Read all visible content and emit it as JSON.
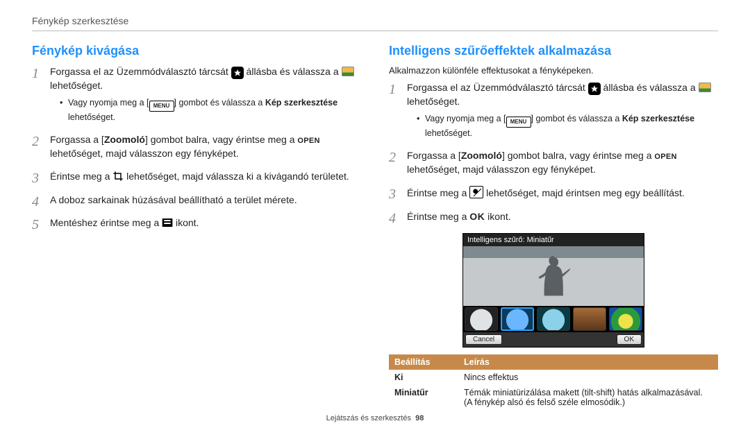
{
  "page_header": "Fénykép szerkesztése",
  "footer": {
    "section": "Lejátszás és szerkesztés",
    "page_no": "98"
  },
  "icons": {
    "star": "csillag",
    "gallery": "galéria",
    "menu": "MENU",
    "crop": "kivágás",
    "save": "mentés",
    "frame": "effektus-keret",
    "ok": "OK"
  },
  "left": {
    "title": "Fénykép kivágása",
    "steps": [
      {
        "pre": "Forgassa el az Üzemmódválasztó tárcsát ",
        "mid": " állásba és válassza a ",
        "post": " lehetőséget.",
        "sub": {
          "pre": "Vagy nyomja meg a [",
          "mid": "] gombot és válassza a ",
          "bold": "Kép szerkesztése",
          "post": " lehetőséget."
        }
      },
      {
        "pre": "Forgassa a [",
        "bold": "Zoomoló",
        "mid": "] gombot balra, vagy érintse meg a ",
        "open": "OPEN",
        "post": " lehetőséget, majd válasszon egy fényképet."
      },
      {
        "pre": "Érintse meg a ",
        "post": " lehetőséget, majd válassza ki a kivágandó területet."
      },
      {
        "text": "A doboz sarkainak húzásával beállítható a terület mérete."
      },
      {
        "pre": "Mentéshez érintse meg a ",
        "post": " ikont."
      }
    ]
  },
  "right": {
    "title": "Intelligens szűrőeffektek alkalmazása",
    "intro": "Alkalmazzon különféle effektusokat a fényképeken.",
    "steps": [
      {
        "pre": "Forgassa el az Üzemmódválasztó tárcsát ",
        "mid": " állásba és válassza a ",
        "post": " lehetőséget.",
        "sub": {
          "pre": "Vagy nyomja meg a [",
          "mid": "] gombot és válassza a ",
          "bold": "Kép szerkesztése",
          "post": " lehetőséget."
        }
      },
      {
        "pre": "Forgassa a [",
        "bold": "Zoomoló",
        "mid": "] gombot balra, vagy érintse meg a ",
        "open": "OPEN",
        "post": " lehetőséget, majd válasszon egy fényképet."
      },
      {
        "pre": "Érintse meg a ",
        "post": " lehetőséget, majd érintsen meg egy beállítást."
      },
      {
        "pre": "Érintse meg a ",
        "post": " ikont."
      }
    ],
    "preview": {
      "title": "Intelligens szűrő: Miniatűr",
      "cancel": "Cancel",
      "ok": "OK"
    },
    "table": {
      "headers": [
        "Beállítás",
        "Leírás"
      ],
      "rows": [
        {
          "name": "Ki",
          "desc": "Nincs effektus"
        },
        {
          "name": "Miniatűr",
          "desc": "Témák miniatürizálása makett (tilt-shift) hatás alkalmazásával. (A fénykép alsó és felső széle elmosódik.)"
        }
      ]
    }
  }
}
